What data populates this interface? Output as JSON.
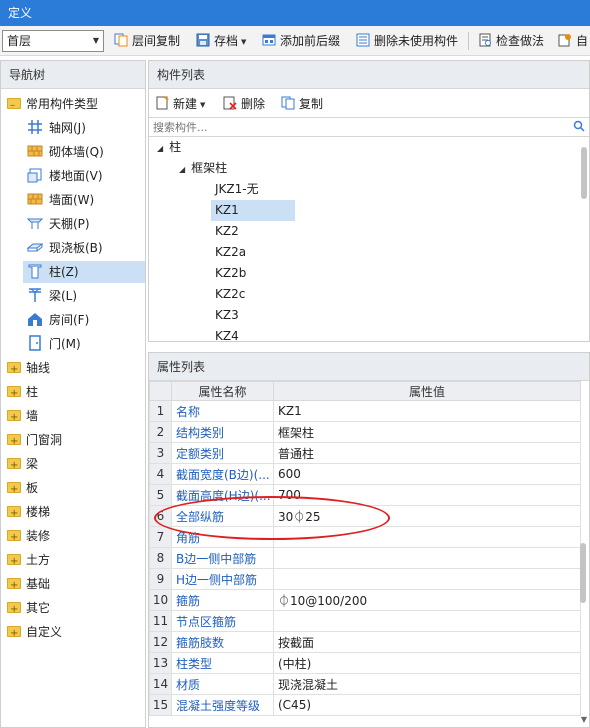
{
  "window": {
    "title": "定义"
  },
  "toolbar": {
    "floor": "首层",
    "buttons": [
      {
        "label": "层间复制",
        "icon": "copy-layers-icon"
      },
      {
        "label": "存档",
        "icon": "archive-icon"
      },
      {
        "label": "添加前后缀",
        "icon": "add-prefix-icon"
      },
      {
        "label": "删除未使用构件",
        "icon": "delete-unused-icon"
      },
      {
        "label": "检查做法",
        "icon": "check-method-icon"
      },
      {
        "label": "自",
        "icon": "auto-icon"
      }
    ]
  },
  "nav": {
    "title": "导航树",
    "root": "常用构件类型",
    "items": [
      {
        "label": "轴网(J)",
        "icon": "axis-grid-icon"
      },
      {
        "label": "砌体墙(Q)",
        "icon": "masonry-wall-icon"
      },
      {
        "label": "楼地面(V)",
        "icon": "floor-icon"
      },
      {
        "label": "墙面(W)",
        "icon": "wall-surface-icon"
      },
      {
        "label": "天棚(P)",
        "icon": "ceiling-icon"
      },
      {
        "label": "现浇板(B)",
        "icon": "cast-slab-icon"
      },
      {
        "label": "柱(Z)",
        "icon": "column-icon"
      },
      {
        "label": "梁(L)",
        "icon": "beam-icon"
      },
      {
        "label": "房间(F)",
        "icon": "room-icon"
      },
      {
        "label": "门(M)",
        "icon": "door-icon"
      }
    ],
    "groups": [
      "轴线",
      "柱",
      "墙",
      "门窗洞",
      "梁",
      "板",
      "楼梯",
      "装修",
      "土方",
      "基础",
      "其它",
      "自定义"
    ]
  },
  "components": {
    "title": "构件列表",
    "new_label": "新建",
    "delete_label": "删除",
    "copy_label": "复制",
    "search_placeholder": "搜索构件...",
    "tree_root": "柱",
    "tree_group": "框架柱",
    "items": [
      "JKZ1-无",
      "KZ1",
      "KZ2",
      "KZ2a",
      "KZ2b",
      "KZ2c",
      "KZ3",
      "KZ4"
    ],
    "selected": "KZ1"
  },
  "properties": {
    "title": "属性列表",
    "col_name": "属性名称",
    "col_value": "属性值",
    "rows": [
      {
        "n": "1",
        "name": "名称",
        "value": "KZ1"
      },
      {
        "n": "2",
        "name": "结构类别",
        "value": "框架柱"
      },
      {
        "n": "3",
        "name": "定额类别",
        "value": "普通柱"
      },
      {
        "n": "4",
        "name": "截面宽度(B边)(...",
        "value": "600"
      },
      {
        "n": "5",
        "name": "截面高度(H边)(...",
        "value": "700"
      },
      {
        "n": "6",
        "name": "全部纵筋",
        "value": "30⏀25"
      },
      {
        "n": "7",
        "name": "角筋",
        "value": ""
      },
      {
        "n": "8",
        "name": "B边一侧中部筋",
        "value": ""
      },
      {
        "n": "9",
        "name": "H边一侧中部筋",
        "value": ""
      },
      {
        "n": "10",
        "name": "箍筋",
        "value": "⏀10@100/200"
      },
      {
        "n": "11",
        "name": "节点区箍筋",
        "value": ""
      },
      {
        "n": "12",
        "name": "箍筋肢数",
        "value": "按截面"
      },
      {
        "n": "13",
        "name": "柱类型",
        "value": "(中柱)"
      },
      {
        "n": "14",
        "name": "材质",
        "value": "现浇混凝土"
      },
      {
        "n": "15",
        "name": "混凝土强度等级",
        "value": "(C45)"
      }
    ]
  },
  "colors": {
    "title_bar": "#2b7bd8",
    "selection": "#cce0f5",
    "property_name": "#1f5fbf",
    "annotation": "#e02020"
  }
}
